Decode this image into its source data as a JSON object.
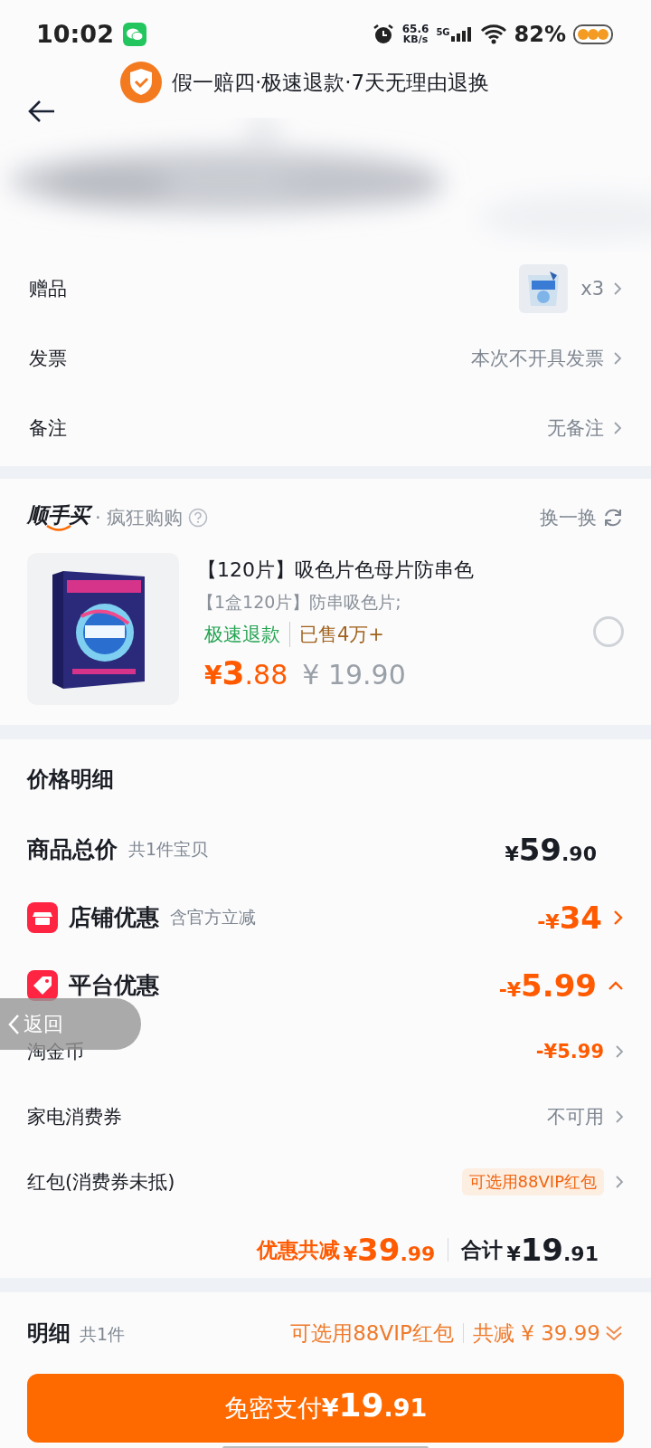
{
  "status_bar": {
    "time": "10:02",
    "net_speed": "65.6",
    "net_unit": "KB/s",
    "network": "5G",
    "battery": "82%"
  },
  "header": {
    "guarantee": "假一赔四·极速退款·7天无理由退换"
  },
  "order_rows": [
    {
      "label": "赠品",
      "kind": "gift",
      "value": "x3"
    },
    {
      "label": "发票",
      "kind": "text",
      "value": "本次不开具发票"
    },
    {
      "label": "备注",
      "kind": "text",
      "value": "无备注"
    }
  ],
  "add_on": {
    "brand": "顺手买",
    "subtitle": "· 疯狂购购",
    "refresh": "换一换",
    "product": {
      "title": "【120片】吸色片色母片防串色",
      "spec": "【1盒120片】防串吸色片;",
      "refund_tag": "极速退款",
      "sold": "已售4万+",
      "price": {
        "prefix": "¥",
        "main": "3",
        "fraction": ".88"
      },
      "original_price": "¥ 19.90",
      "selected": false
    }
  },
  "price_details": {
    "title": "价格明细",
    "rows": [
      {
        "kind": "total",
        "label": "商品总价",
        "note": "共1件宝贝",
        "amount": {
          "prefix": "¥",
          "main": "59",
          "fraction": ".90"
        },
        "highlight": false
      },
      {
        "kind": "shop",
        "label": "店铺优惠",
        "note": "含官方立减",
        "amount": {
          "prefix": "-¥",
          "main": "34"
        },
        "highlight": true,
        "chevron": true
      },
      {
        "kind": "tag",
        "label": "平台优惠",
        "amount": {
          "prefix": "-¥",
          "main": "5.99"
        },
        "highlight": true,
        "expanded": true
      }
    ],
    "sub_rows": [
      {
        "kind": "amount",
        "label": "淘金币",
        "value": "-¥5.99"
      },
      {
        "kind": "muted",
        "label": "家电消费券",
        "value": "不可用"
      },
      {
        "kind": "badge",
        "label": "红包(消费券未抵)",
        "value": "可选用88VIP红包"
      }
    ],
    "summary": {
      "discount_label": "优惠共减",
      "discount": {
        "prefix": "¥",
        "main": "39",
        "fraction": ".99"
      },
      "total_label": "合计",
      "total": {
        "prefix": "¥",
        "main": "19",
        "fraction": ".91"
      }
    }
  },
  "footer": {
    "title": "明细",
    "count": "共1件",
    "vip": "可选用88VIP红包",
    "saved": "共减 ¥ 39.99",
    "pay_button": {
      "label": "免密支付",
      "prefix": "¥",
      "main": "19",
      "fraction": ".91"
    }
  },
  "floating_back": {
    "label": "返回"
  }
}
